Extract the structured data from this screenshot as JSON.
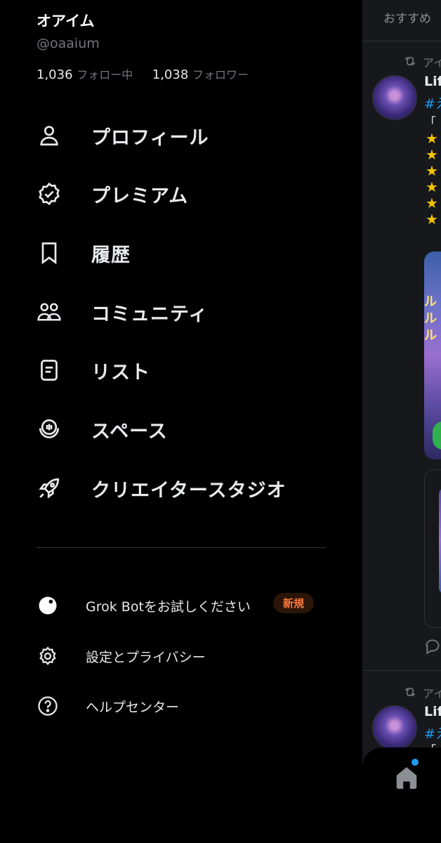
{
  "profile": {
    "name": "オアイム",
    "handle": "@oaaium",
    "following_count": "1,036",
    "following_label": "フォロー中",
    "followers_count": "1,038",
    "followers_label": "フォロワー"
  },
  "menu": {
    "items": [
      {
        "label": "プロフィール",
        "icon": "person-icon"
      },
      {
        "label": "プレミアム",
        "icon": "verified-badge-icon"
      },
      {
        "label": "履歴",
        "icon": "bookmark-icon"
      },
      {
        "label": "コミュニティ",
        "icon": "people-icon"
      },
      {
        "label": "リスト",
        "icon": "list-icon"
      },
      {
        "label": "スペース",
        "icon": "spaces-mic-icon"
      },
      {
        "label": "クリエイタースタジオ",
        "icon": "rocket-icon"
      }
    ]
  },
  "secondary": {
    "items": [
      {
        "label": "Grok Botをお試しください",
        "icon": "grok-icon",
        "badge": "新規"
      },
      {
        "label": "設定とプライバシー",
        "icon": "gear-icon"
      },
      {
        "label": "ヘルプセンター",
        "icon": "help-icon"
      }
    ]
  },
  "feed": {
    "tab_label": "おすすめ",
    "posts": [
      {
        "retweet_label": "アイ",
        "author": "Lif",
        "hashtag": "#え",
        "text": "「",
        "stars": [
          "★",
          "★",
          "★",
          "★",
          "★",
          "★"
        ]
      },
      {
        "retweet_label": "アイ",
        "author": "Lif",
        "hashtag": "#え",
        "text": "「"
      }
    ],
    "media_text": "ルルル"
  },
  "colors": {
    "background": "#000000",
    "feed_background": "#16181c",
    "accent_blue": "#1d9bf0",
    "badge_orange": "#ff7a3d",
    "muted_text": "#71767b"
  }
}
